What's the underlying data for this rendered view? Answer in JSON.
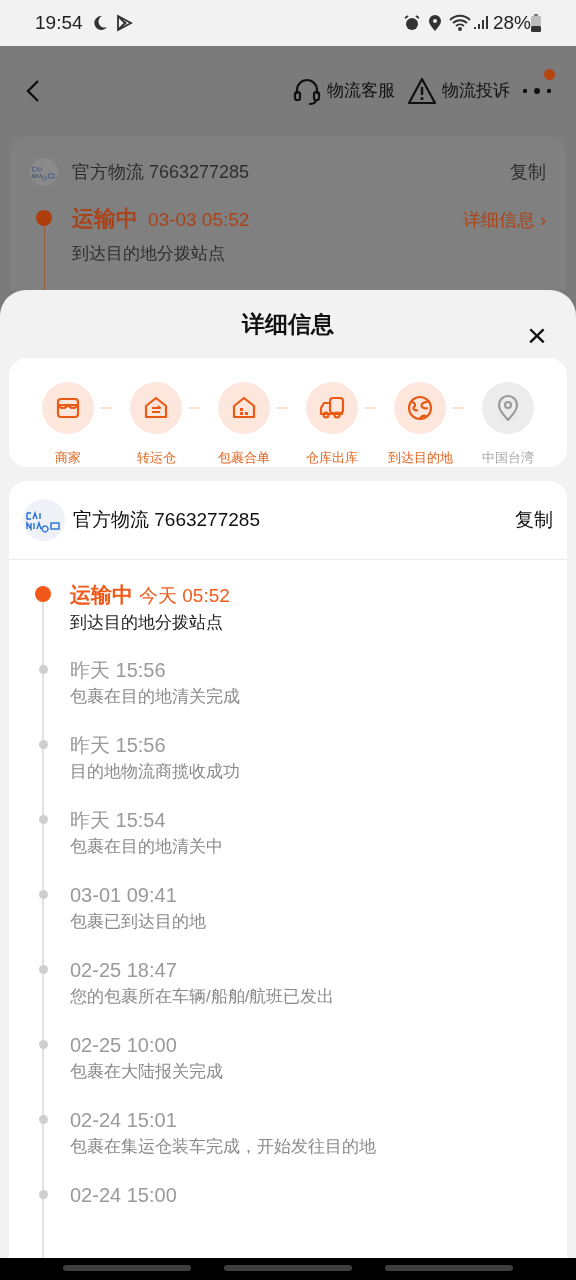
{
  "status_bar": {
    "time": "19:54",
    "battery": "28%"
  },
  "background_page": {
    "actions": [
      "物流客服",
      "物流投诉"
    ],
    "has_notification": true,
    "carrier": "官方物流 7663277285",
    "copy": "复制",
    "status": "运输中",
    "time": "03-03 05:52",
    "details_link": "详细信息 ›",
    "description": "到达目的地分拨站点"
  },
  "sheet": {
    "title": "详细信息",
    "close": "×",
    "stages": [
      {
        "kind": "store",
        "label": "商家",
        "reached": true
      },
      {
        "kind": "transfer",
        "label": "转运仓",
        "reached": true
      },
      {
        "kind": "package",
        "label": "包裹合单",
        "reached": true
      },
      {
        "kind": "truck",
        "label": "仓库出库",
        "reached": true
      },
      {
        "kind": "globe",
        "label": "到达目的地",
        "reached": true
      },
      {
        "kind": "pin",
        "label": "中国台湾",
        "reached": false
      }
    ],
    "carrier": "官方物流 7663277285",
    "copy": "复制",
    "events": [
      {
        "current": true,
        "status": "运输中",
        "time": "今天 05:52",
        "description": "到达目的地分拨站点"
      },
      {
        "current": false,
        "time": "昨天 15:56",
        "description": "包裹在目的地清关完成"
      },
      {
        "current": false,
        "time": "昨天 15:56",
        "description": "目的地物流商揽收成功"
      },
      {
        "current": false,
        "time": "昨天 15:54",
        "description": "包裹在目的地清关中"
      },
      {
        "current": false,
        "time": "03-01 09:41",
        "description": "包裹已到达目的地"
      },
      {
        "current": false,
        "time": "02-25 18:47",
        "description": "您的包裹所在车辆/船舶/航班已发出"
      },
      {
        "current": false,
        "time": "02-25 10:00",
        "description": "包裹在大陆报关完成"
      },
      {
        "current": false,
        "time": "02-24 15:01",
        "description": "包裹在集运仓装车完成，开始发往目的地"
      },
      {
        "current": false,
        "time": "02-24 15:00"
      }
    ]
  }
}
